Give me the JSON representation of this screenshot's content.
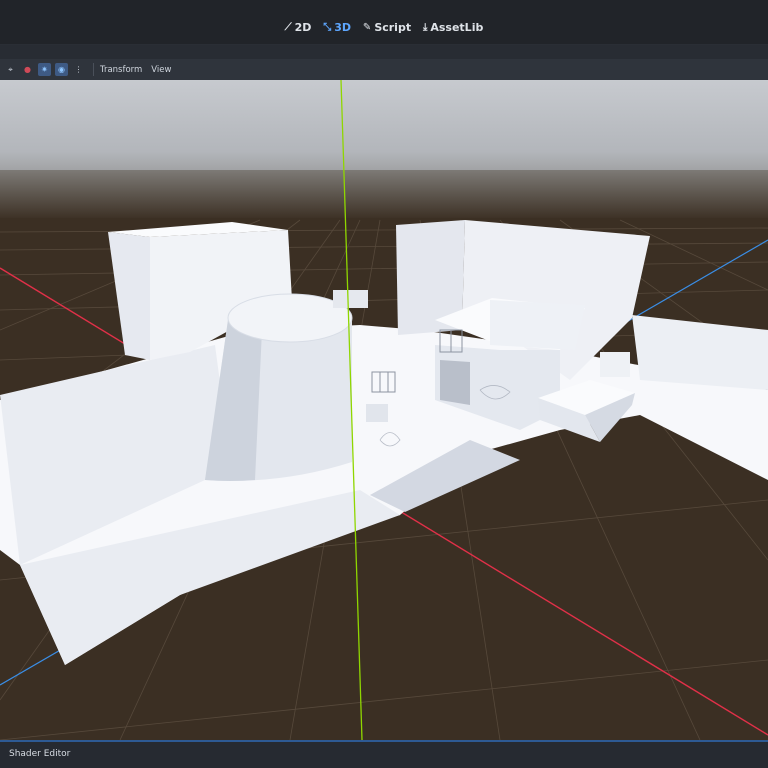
{
  "workspace": {
    "tabs": [
      {
        "label": "2D",
        "icon": "canvas-2d-icon",
        "active": false
      },
      {
        "label": "3D",
        "icon": "node-3d-icon",
        "active": true
      },
      {
        "label": "Script",
        "icon": "script-icon",
        "active": false
      },
      {
        "label": "AssetLib",
        "icon": "download-icon",
        "active": false
      }
    ]
  },
  "toolbar": {
    "icons": [
      "snap-icon",
      "record-icon",
      "sun-toggle-icon",
      "environment-toggle-icon",
      "more-options-icon"
    ],
    "menus": {
      "transform": "Transform",
      "view": "View"
    }
  },
  "bottom_panel": {
    "tab": "Shader Editor"
  },
  "colors": {
    "accent": "#5ea7ff",
    "sky_top": "#b5b9bf",
    "ground": "#3b2f23",
    "axis_x": "#e03048",
    "axis_y": "#8fd600",
    "axis_z": "#3a8ee6",
    "geometry": "#f4f6fa"
  }
}
